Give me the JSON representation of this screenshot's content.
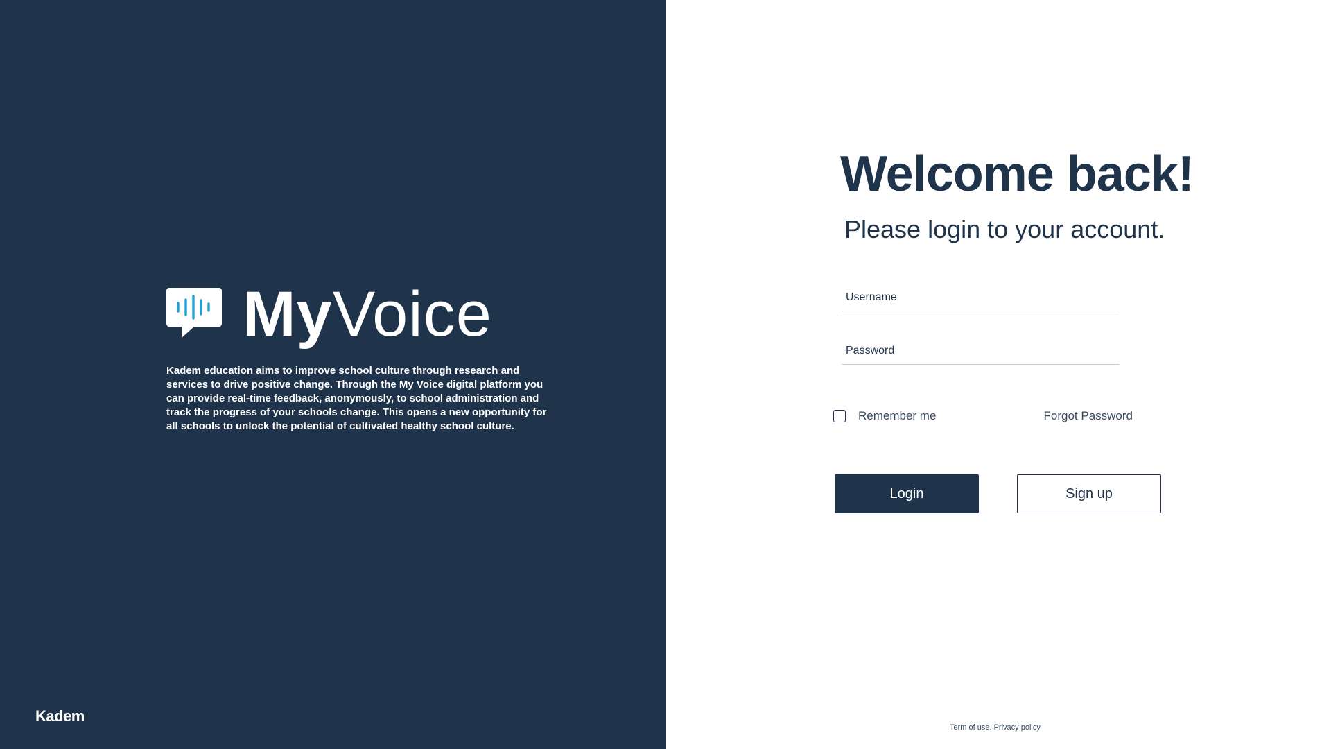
{
  "brand": {
    "name_bold": "My",
    "name_light": "Voice",
    "icon": "speech-bubble-soundwave-icon",
    "description": "Kadem education aims to improve school culture through research and services to drive positive change.  Through the My Voice digital platform you can provide real-time feedback, anonymously, to school administration and track the progress of your schools change.  This opens a new opportunity for all schools to unlock the potential of cultivated healthy school culture.",
    "company": "Kadem"
  },
  "login": {
    "heading": "Welcome back!",
    "subheading": "Please login to your account.",
    "username_placeholder": "Username",
    "password_placeholder": "Password",
    "remember_label": "Remember me",
    "remember_checked": false,
    "forgot_label": "Forgot Password",
    "login_label": "Login",
    "signup_label": "Sign up"
  },
  "footer": {
    "terms": "Term of use.",
    "privacy": "Privacy policy"
  },
  "colors": {
    "navy": "#1f344b",
    "accent_blue": "#1ba3d6",
    "background": "#ffffff"
  }
}
